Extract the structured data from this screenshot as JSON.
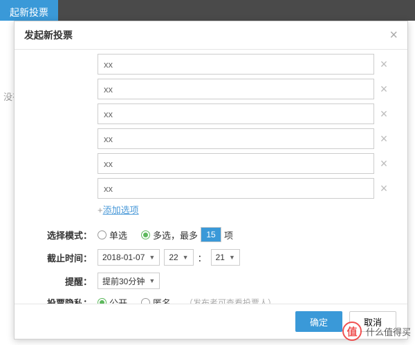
{
  "background": {
    "tab": "起新投票",
    "hint": "没有"
  },
  "modal": {
    "title": "发起新投票",
    "options": [
      {
        "value": "xx"
      },
      {
        "value": "xx"
      },
      {
        "value": "xx"
      },
      {
        "value": "xx"
      },
      {
        "value": "xx"
      },
      {
        "value": "xx"
      }
    ],
    "add_option": {
      "plus": "+",
      "label": "添加选项"
    },
    "mode": {
      "label": "选择模式：",
      "single": "单选",
      "multi_prefix": "多选，最多",
      "multi_max": "15",
      "multi_suffix": "项"
    },
    "deadline": {
      "label": "截止时间：",
      "date": "2018-01-07",
      "hour": "22",
      "sep": "：",
      "minute": "21"
    },
    "reminder": {
      "label": "提醒：",
      "value": "提前30分钟"
    },
    "privacy": {
      "label": "投票隐私：",
      "public": "公开",
      "anon": "匿名",
      "hint": "（发布者可查看投票人）"
    },
    "footer": {
      "ok": "确定",
      "cancel": "取消"
    }
  },
  "watermark": {
    "badge": "值",
    "text": "什么值得买"
  }
}
